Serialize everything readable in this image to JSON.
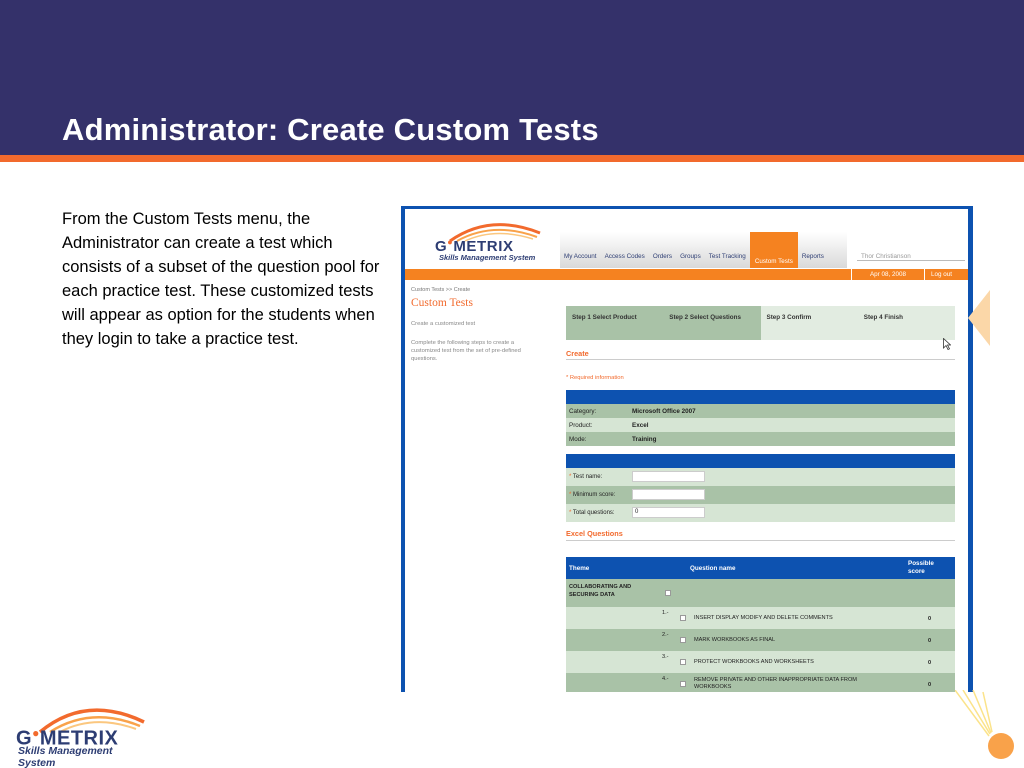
{
  "slide": {
    "title": "Administrator: Create Custom Tests",
    "body": "From the Custom Tests menu, the Administrator can create a test which consists of a subset of the question pool for each practice test.  These customized tests will appear as option for the students when they login to take a practice test."
  },
  "logo": {
    "brand_pre": "G",
    "brand_post": "METRIX",
    "tagline": "Skills Management System"
  },
  "app": {
    "nav": [
      "My Account",
      "Access Codes",
      "Orders",
      "Groups",
      "Test Tracking",
      "Custom Tests",
      "Reports"
    ],
    "active_nav": "Custom Tests",
    "user": "Thor Christianson",
    "date": "Apr 08, 2008",
    "logout": "Log out",
    "breadcrumb": "Custom Tests >> Create",
    "page_title": "Custom Tests",
    "page_subtitle": "Create a customized test",
    "page_desc": "Complete the following steps to create a customized test from the set of pre-defined questions.",
    "steps": [
      "Step 1 Select Product",
      "Step 2 Select Questions",
      "Step 3 Confirm",
      "Step 4 Finish"
    ],
    "create_heading": "Create",
    "required_note": "* Required information",
    "info": [
      {
        "label": "Category:",
        "value": "Microsoft Office 2007"
      },
      {
        "label": "Product:",
        "value": "Excel"
      },
      {
        "label": "Mode:",
        "value": "Training"
      }
    ],
    "fields": [
      {
        "label": "Test name:",
        "value": ""
      },
      {
        "label": "Minimum score:",
        "value": ""
      },
      {
        "label": "Total questions:",
        "value": "0"
      }
    ],
    "questions_heading": "Excel Questions",
    "table_headers": {
      "theme": "Theme",
      "question": "Question name",
      "score": "Possible score"
    },
    "theme": "COLLABORATING AND SECURING DATA",
    "questions": [
      {
        "num": "1.-",
        "name": "INSERT DISPLAY MODIFY AND DELETE COMMENTS",
        "score": "0"
      },
      {
        "num": "2.-",
        "name": "MARK WORKBOOKS AS FINAL",
        "score": "0"
      },
      {
        "num": "3.-",
        "name": "PROTECT WORKBOOKS AND WORKSHEETS",
        "score": "0"
      },
      {
        "num": "4.-",
        "name": "REMOVE PRIVATE AND OTHER INAPPROPRIATE DATA FROM WORKBOOKS",
        "score": "0"
      }
    ]
  },
  "colors": {
    "header_navy": "#34316a",
    "accent_orange": "#f26a2d",
    "app_blue": "#0d52b0",
    "row_green_dark": "#a9c2a7",
    "row_green_light": "#d6e5d4"
  }
}
